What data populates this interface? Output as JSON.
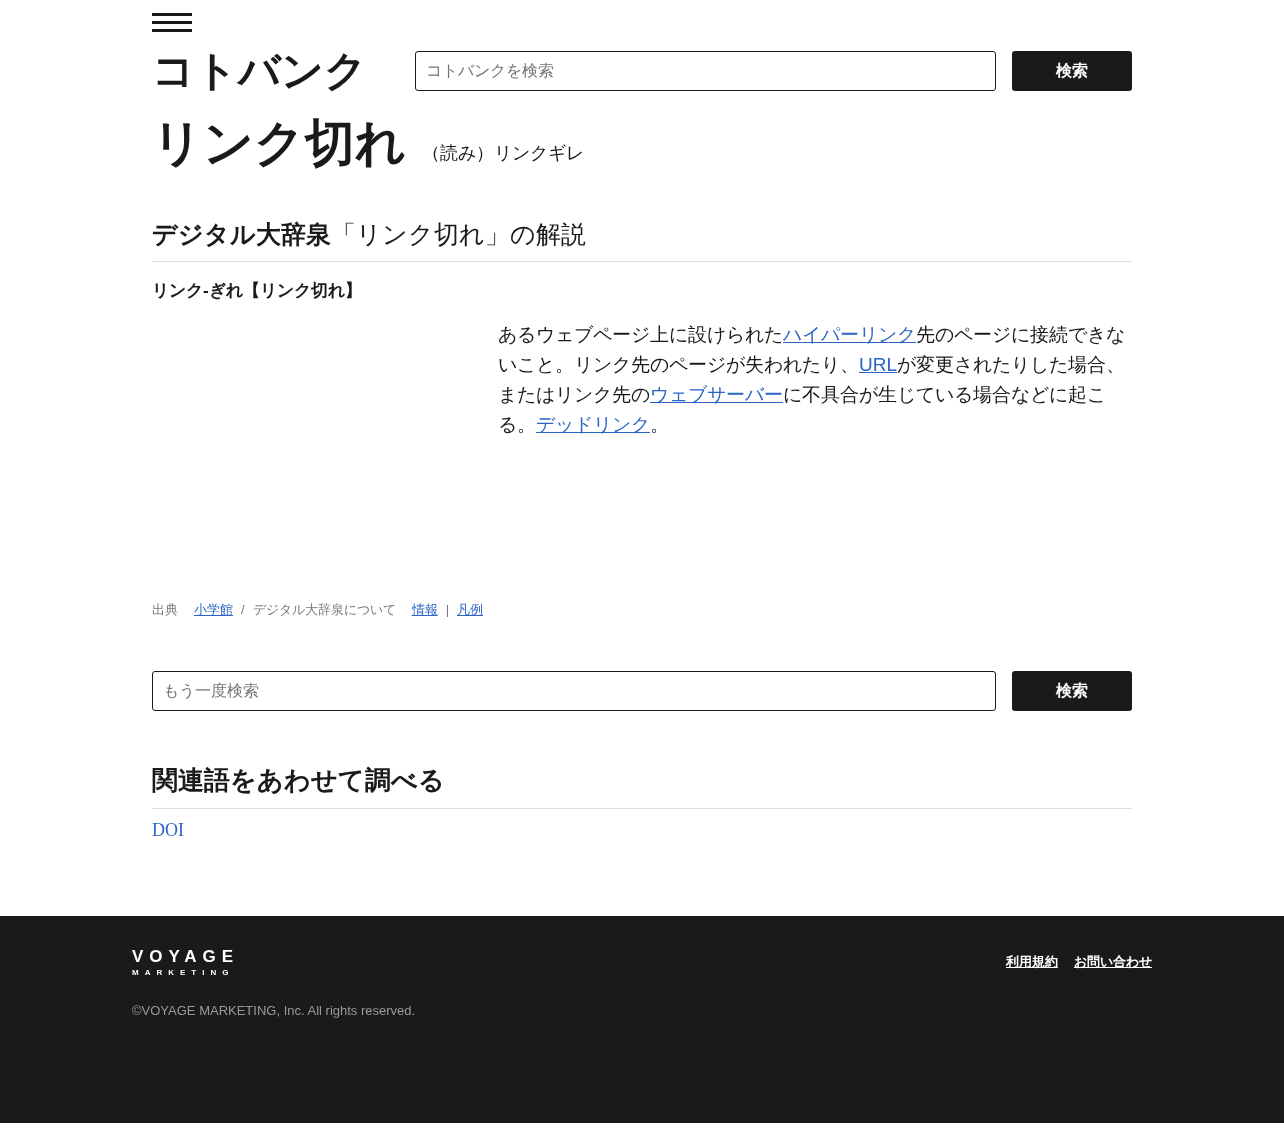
{
  "header": {
    "logo": "コトバンク",
    "search": {
      "placeholder": "コトバンクを検索"
    },
    "search_button": "検索"
  },
  "entry": {
    "title": "リンク切れ",
    "reading": "（読み）リンクギレ"
  },
  "section": {
    "source_name": "デジタル大辞泉",
    "heading_rest": "「リンク切れ」の解説",
    "headword": "リンク-ぎれ【リンク切れ】",
    "definition": [
      {
        "kind": "text",
        "text": "あるウェブページ上に設けられた"
      },
      {
        "kind": "link",
        "text": "ハイパーリンク"
      },
      {
        "kind": "text",
        "text": "先のページに接続できないこと。リンク先のページが失われたり、"
      },
      {
        "kind": "link",
        "text": "URL"
      },
      {
        "kind": "text",
        "text": "が変更されたりした場合、またはリンク先の"
      },
      {
        "kind": "link",
        "text": "ウェブサーバー"
      },
      {
        "kind": "text",
        "text": "に不具合が生じている場合などに起こる。"
      },
      {
        "kind": "link",
        "text": "デッドリンク"
      },
      {
        "kind": "text",
        "text": "。"
      }
    ],
    "source": [
      {
        "kind": "text",
        "text": "出典"
      },
      {
        "kind": "link",
        "text": "小学館"
      },
      {
        "kind": "text",
        "text": "/"
      },
      {
        "kind": "text",
        "text": "デジタル大辞泉について"
      },
      {
        "kind": "link",
        "text": "情報"
      },
      {
        "kind": "text",
        "text": "|"
      },
      {
        "kind": "link",
        "text": "凡例"
      }
    ]
  },
  "search_again": {
    "placeholder": "もう一度検索",
    "button": "検索"
  },
  "related": {
    "heading": "関連語をあわせて調べる",
    "items": [
      "DOI"
    ]
  },
  "footer": {
    "logo_top": "VOYAGE",
    "logo_bottom": "MARKETING",
    "links": [
      "利用規約",
      "お問い合わせ"
    ],
    "copyright": "©VOYAGE MARKETING, Inc. All rights reserved."
  }
}
